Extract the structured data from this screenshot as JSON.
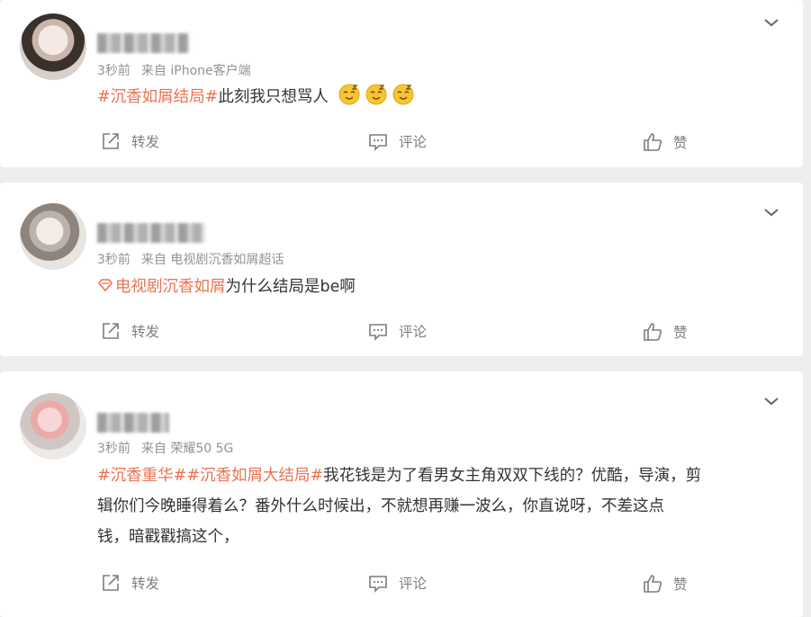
{
  "posts": [
    {
      "meta_time": "3秒前",
      "meta_source": "来自 iPhone客户端",
      "tag": "#沉香如屑结局#",
      "text": "此刻我只想骂人",
      "emoji_name": "sleepy-smile-emoji",
      "actions": {
        "repost": "转发",
        "comment": "评论",
        "like": "赞"
      }
    },
    {
      "meta_time": "3秒前",
      "meta_source": "来自 电视剧沉香如屑超话",
      "tag": "电视剧沉香如屑",
      "text": "为什么结局是be啊",
      "actions": {
        "repost": "转发",
        "comment": "评论",
        "like": "赞"
      }
    },
    {
      "meta_time": "3秒前",
      "meta_source": "来自 荣耀50 5G",
      "tags": [
        "#沉香重华#",
        "#沉香如屑大结局#"
      ],
      "text_lines": [
        "我花钱是为了看男女主角双双下线的？优酷，导演，剪",
        "辑你们今晚睡得着么？番外什么时候出，不就想再赚一波么，你直说呀，不差这点",
        "钱，暗戳戳搞这个，"
      ],
      "actions": {
        "repost": "转发",
        "comment": "评论",
        "like": "赞"
      }
    }
  ],
  "colors": {
    "tag": "#eb7350",
    "meta": "#939393",
    "action": "#808080",
    "background": "#eeeeee"
  }
}
